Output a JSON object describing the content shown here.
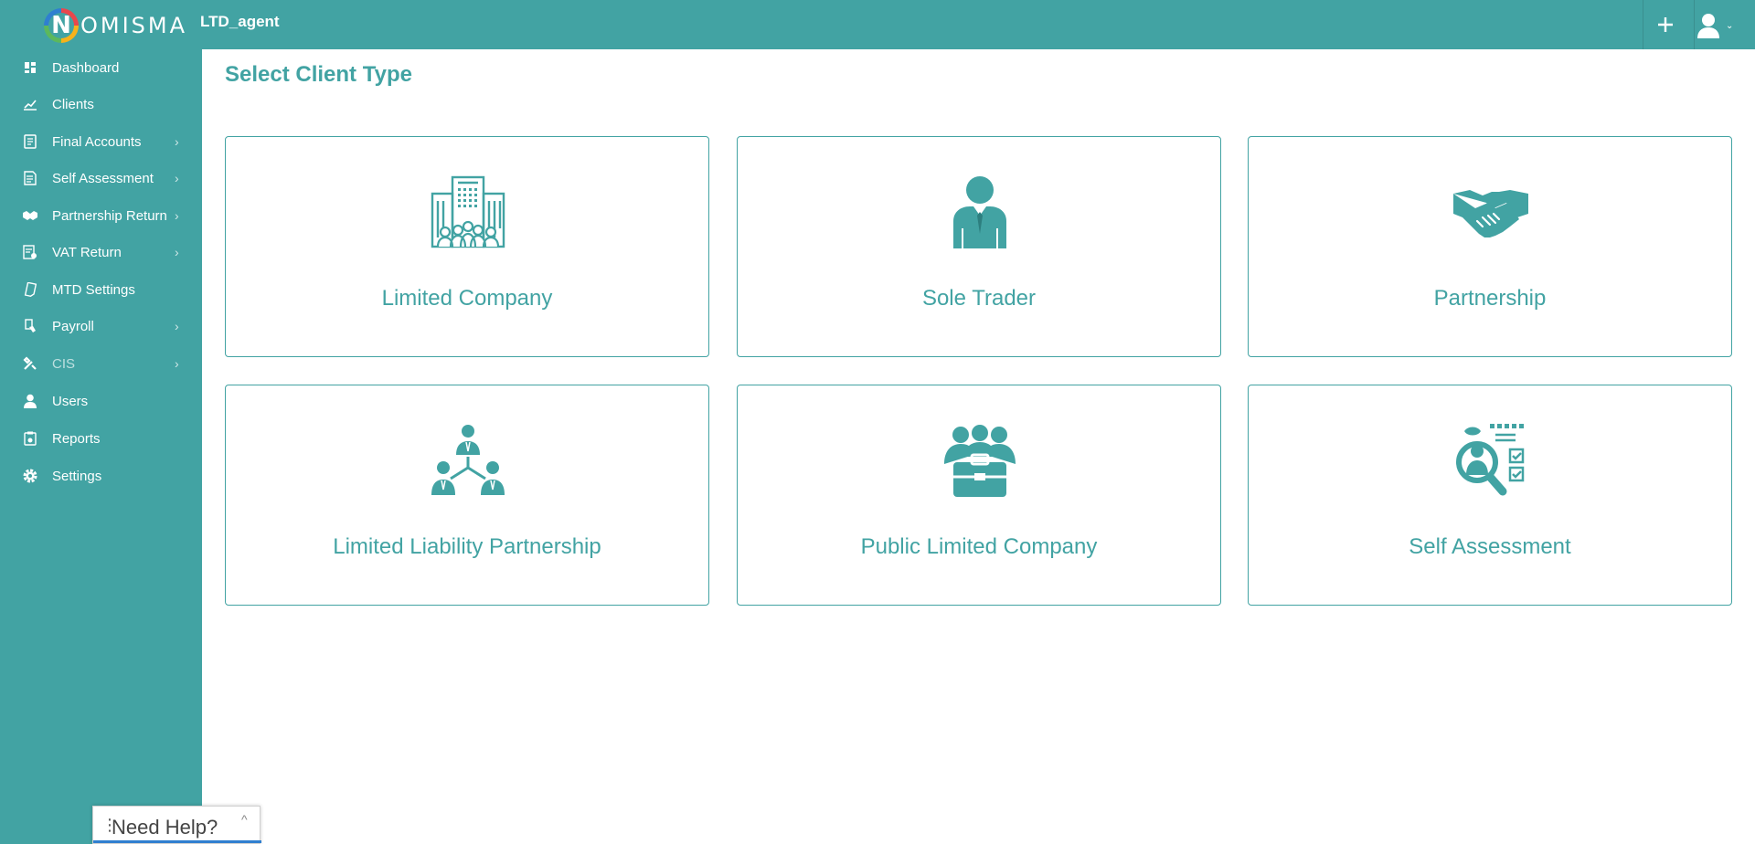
{
  "brand": {
    "logo_letter": "N",
    "logo_text": "OMISMA"
  },
  "header": {
    "agent_name": "LTD_agent",
    "plus_icon": "plus-icon",
    "user_icon": "user-icon"
  },
  "sidebar": {
    "items": [
      {
        "label": "Dashboard",
        "icon": "dashboard-icon",
        "has_submenu": false
      },
      {
        "label": "Clients",
        "icon": "chart-icon",
        "has_submenu": false
      },
      {
        "label": "Final Accounts",
        "icon": "ledger-icon",
        "has_submenu": true
      },
      {
        "label": "Self Assessment",
        "icon": "document-icon",
        "has_submenu": true
      },
      {
        "label": "Partnership Return",
        "icon": "handshake-icon",
        "has_submenu": true
      },
      {
        "label": "VAT Return",
        "icon": "vat-icon",
        "has_submenu": true
      },
      {
        "label": "MTD Settings",
        "icon": "mtd-icon",
        "has_submenu": false
      },
      {
        "label": "Payroll",
        "icon": "payroll-icon",
        "has_submenu": true
      },
      {
        "label": "CIS",
        "icon": "tools-icon",
        "has_submenu": true
      },
      {
        "label": "Users",
        "icon": "user-icon",
        "has_submenu": false
      },
      {
        "label": "Reports",
        "icon": "reports-icon",
        "has_submenu": false
      },
      {
        "label": "Settings",
        "icon": "gear-icon",
        "has_submenu": false
      }
    ]
  },
  "main": {
    "title": "Select Client Type",
    "cards": [
      {
        "label": "Limited Company",
        "icon": "office-building-icon"
      },
      {
        "label": "Sole Trader",
        "icon": "businessman-icon"
      },
      {
        "label": "Partnership",
        "icon": "handshake-icon"
      },
      {
        "label": "Limited Liability Partnership",
        "icon": "org-hierarchy-icon"
      },
      {
        "label": "Public Limited Company",
        "icon": "team-briefcase-icon"
      },
      {
        "label": "Self Assessment",
        "icon": "checklist-search-icon"
      }
    ]
  },
  "help_widget": {
    "label": "Need Help?",
    "grip": "⋮",
    "chevron": "^"
  },
  "colors": {
    "primary": "#42a3a3",
    "text_on_primary": "#ffffff",
    "background": "#ffffff"
  }
}
